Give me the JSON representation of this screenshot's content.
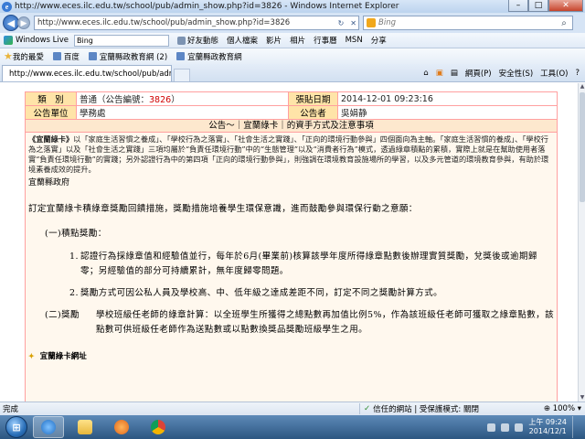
{
  "window": {
    "title": "http://www.eces.ilc.edu.tw/school/pub/admin_show.php?id=3826 - Windows Internet Explorer",
    "minimize": "–",
    "maximize": "□",
    "close": "✕"
  },
  "address": {
    "back": "◀",
    "forward": "▶",
    "url": "http://www.eces.ilc.edu.tw/school/pub/admin_show.php?id=3826",
    "refresh": "↻",
    "stop": "✕",
    "search_placeholder": "Bing",
    "search_icon": "⌕"
  },
  "live_toolbar": {
    "brand": "Windows Live",
    "search_value": "Bing",
    "items": [
      "好友動態",
      "個人檔案",
      "影片",
      "相片",
      "行事曆",
      "MSN",
      "分享"
    ]
  },
  "favorites": {
    "label": "我的最愛",
    "items": [
      "百度",
      "宜蘭縣政教育網 (2)",
      "宜蘭縣政教育網"
    ]
  },
  "tab": {
    "label": "http://www.eces.ilc.edu.tw/school/pub/admin...",
    "close": "✕"
  },
  "commands": [
    "網頁(P)",
    "安全性(S)",
    "工具(O)"
  ],
  "notice": {
    "type_label": "類　別",
    "type_value": "普通（公告編號：",
    "notice_no": "3826",
    "type_suffix": "）",
    "posted_label": "張貼日期",
    "posted_value": "2014-12-01 09:23:16",
    "unit_label": "公告單位",
    "unit_value": "學務處",
    "author_label": "公告者",
    "author_value": "吳娟静",
    "subject": "公告～｜宜蘭綠卡｜的資手方式及注意事項",
    "intro_bold": "《宜蘭綠卡》",
    "intro": "以「家庭生活習慣之養成」、「學校行為之落實」、「社會生活之實踐」、「正向的環境行動參與」四個面向為主軸。「家庭生活習慣的養成」、「學校行為之落實」以及「社會生活之實踐」三項均屬於“負責任環境行動”中的“生態管理”以及“消費者行為”模式，透過綠章積點的累積，實際上就是在幫助使用者落實“負責任環境行動”的實踐；另外認證行為中的第四項「正向的環境行動參與」，則強調在環境教育設施場所的學習，以及多元管道的環境教育參與，有助於環境素養成效的提升。",
    "gov": "宜蘭縣政府",
    "para1": "訂定宜蘭綠卡積綠章獎勵回饋措施，獎勵措施培養學生環保意識，進而鼓勵參與環保行動之意願：",
    "head1": "(一)積點獎勵：",
    "item1_num": "1.",
    "item1": "認證行為採綠章值和經驗值並行，每年於6月(畢業前)核算該學年度所得綠章點數後辦理實質獎勵，兌獎後或逾期歸零；另經驗值的部分可持續累計，無年度歸零問題。",
    "item2_num": "2.",
    "item2": "獎勵方式可因公私人員及學校高、中、低年級之達成差距不同，訂定不同之獎勵計算方式。",
    "head2": "(二)獎勵",
    "head2_text": "學校班級任老師的綠章計算：以全班學生所獲得之總點數再加值比例5%，作為該班級任老師可獲取之綠章點數，該點數可供班級任老師作為送點數或以點數換獎品獎勵班級學生之用。",
    "footer_link": "宜蘭綠卡網址",
    "footer_bullet": "✦"
  },
  "status": {
    "done": "完成",
    "zone_check": "✓",
    "zone": "信任的網站 | 受保護模式: 關閉",
    "zoom": "⊕ 100% ▾"
  },
  "taskbar": {
    "start": "⊞",
    "time": "上午 09:24",
    "date": "2014/12/1"
  },
  "colors": {
    "label_bg": "#ffe4a8",
    "border": "#ffa0a0",
    "body_bg": "#fff8ee",
    "notice_red": "#d00000"
  }
}
